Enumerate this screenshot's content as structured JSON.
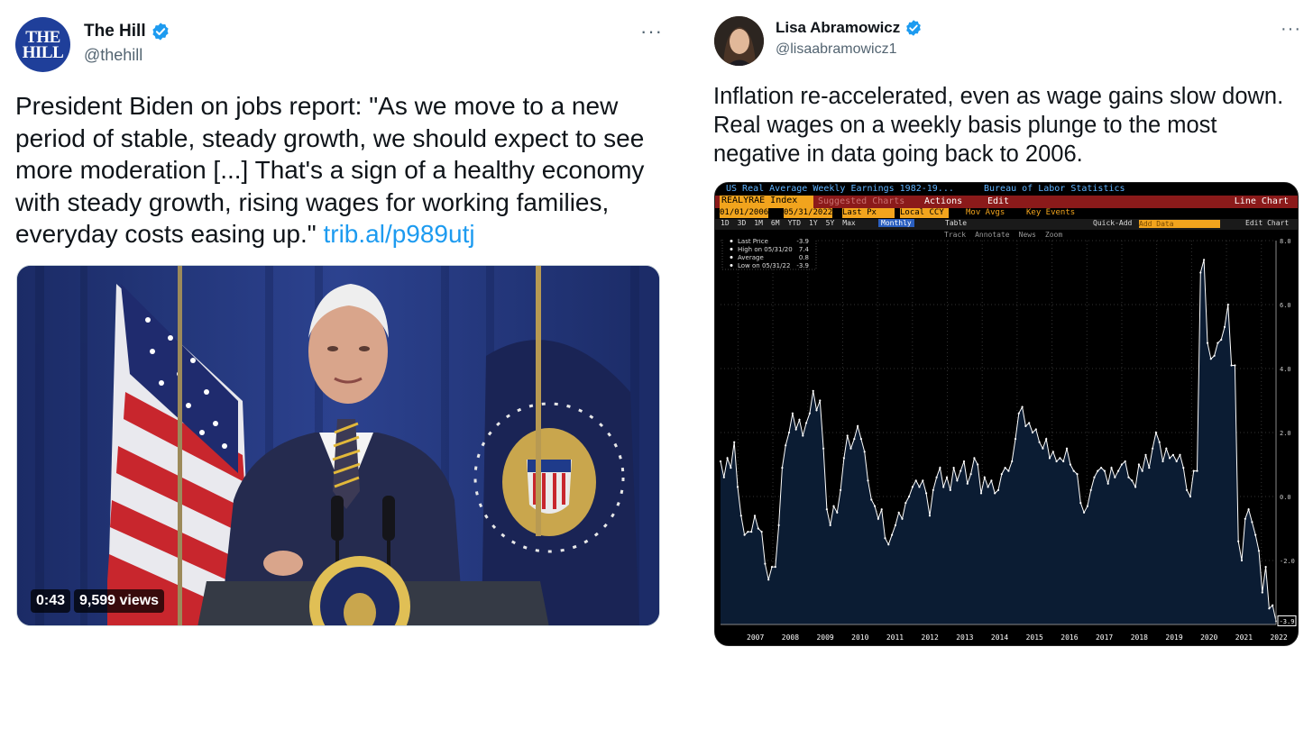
{
  "left_tweet": {
    "avatar_text_line1": "THE",
    "avatar_text_line2": "HILL",
    "display_name": "The Hill",
    "handle": "@thehill",
    "more_label": "···",
    "text": "President Biden on jobs report: \"As we move to a new period of stable, steady growth, we should expect to see more moderation [...] That's a sign of a healthy economy with steady growth, rising wages for working families, everyday costs easing up.\" ",
    "link": "trib.al/p989utj",
    "video": {
      "duration": "0:43",
      "views": "9,599 views"
    }
  },
  "right_tweet": {
    "display_name": "Lisa Abramowicz",
    "handle": "@lisaabramowicz1",
    "more_label": "···",
    "text": "Inflation re-accelerated, even as wage gains slow down. Real wages on a weekly basis plunge to the most negative in data going back to 2006."
  },
  "chart_ui": {
    "title": "US Real Average Weekly Earnings 1982-19...",
    "source": "Bureau of Labor Statistics",
    "ticker": "REALYRAE Index",
    "suggested": "Suggested Charts",
    "actions": "Actions",
    "edit": "Edit",
    "chart_type": "Line Chart",
    "start_date": "01/01/2006",
    "end_date": "05/31/2022",
    "field": "Last Px",
    "currency": "Local CCY",
    "mov_avgs": "Mov Avgs",
    "key_events": "Key Events",
    "ranges": [
      "1D",
      "3D",
      "1M",
      "6M",
      "YTD",
      "1Y",
      "5Y",
      "Max"
    ],
    "frequency": "Monthly",
    "table": "Table",
    "quick_add": "Quick-Add",
    "add_data": "Add Data",
    "edit_chart": "Edit Chart",
    "tools": [
      "Track",
      "Annotate",
      "News",
      "Zoom"
    ],
    "legend": [
      {
        "label": "Last Price",
        "value": "-3.9"
      },
      {
        "label": "High on 05/31/20",
        "value": "7.4"
      },
      {
        "label": "Average",
        "value": "0.8"
      },
      {
        "label": "Low on 05/31/22",
        "value": "-3.9"
      }
    ],
    "last_value_tag": "-3.9"
  },
  "chart_data": {
    "type": "area",
    "series_name": "REALYRAE Index",
    "y_ticks": [
      "8.0",
      "6.0",
      "4.0",
      "2.0",
      "0.0",
      "-2.0"
    ],
    "ylim": [
      -4.0,
      8.0
    ],
    "x_ticks": [
      "2007",
      "2008",
      "2009",
      "2010",
      "2011",
      "2012",
      "2013",
      "2014",
      "2015",
      "2016",
      "2017",
      "2018",
      "2019",
      "2020",
      "2021",
      "2022"
    ],
    "x_start": 2006.5,
    "x_end": 2022.42,
    "values": [
      1.1,
      0.6,
      1.2,
      0.9,
      1.7,
      0.3,
      -0.6,
      -1.2,
      -1.1,
      -1.1,
      -0.6,
      -1.0,
      -1.1,
      -2.1,
      -2.6,
      -2.2,
      -2.2,
      -0.9,
      0.9,
      1.6,
      2.0,
      2.6,
      2.1,
      2.4,
      1.9,
      2.3,
      2.6,
      3.3,
      2.7,
      3.0,
      1.5,
      -0.4,
      -0.9,
      -0.3,
      -0.5,
      0.2,
      1.2,
      1.9,
      1.5,
      1.8,
      2.2,
      1.8,
      1.4,
      0.5,
      -0.1,
      -0.3,
      -0.7,
      -0.4,
      -1.3,
      -1.5,
      -1.2,
      -0.9,
      -0.5,
      -0.7,
      -0.2,
      0.0,
      0.3,
      0.5,
      0.3,
      0.5,
      0.1,
      -0.6,
      0.2,
      0.6,
      0.9,
      0.3,
      0.6,
      0.2,
      0.9,
      0.5,
      0.8,
      1.1,
      0.4,
      0.7,
      1.2,
      1.0,
      0.1,
      0.6,
      0.3,
      0.5,
      0.1,
      0.2,
      0.7,
      0.9,
      0.8,
      1.1,
      1.8,
      2.6,
      2.8,
      2.2,
      2.3,
      2.0,
      2.1,
      1.7,
      1.5,
      1.8,
      1.2,
      1.4,
      1.1,
      1.2,
      1.1,
      1.5,
      1.0,
      0.8,
      0.7,
      -0.2,
      -0.5,
      -0.3,
      0.2,
      0.6,
      0.8,
      0.9,
      0.8,
      0.4,
      0.9,
      0.6,
      0.8,
      1.0,
      1.1,
      0.6,
      0.5,
      0.3,
      1.0,
      0.8,
      1.3,
      0.9,
      1.5,
      2.0,
      1.7,
      1.1,
      1.5,
      1.2,
      1.3,
      1.1,
      1.3,
      0.9,
      0.2,
      0.0,
      0.8,
      0.8,
      7.0,
      7.4,
      4.8,
      4.3,
      4.4,
      4.8,
      4.9,
      5.3,
      6.0,
      4.1,
      4.1,
      -1.4,
      -2.0,
      -0.7,
      -0.4,
      -0.8,
      -1.2,
      -1.7,
      -3.0,
      -2.2,
      -3.5,
      -3.4,
      -3.9
    ]
  },
  "colors": {
    "link": "#1d9bf0",
    "verified": "#1d9bf0",
    "chart_line": "#ffffff",
    "chart_fill": "#0b1c33",
    "bbg_red": "#8b1a1a",
    "bbg_orange": "#f2a41d",
    "bbg_blue_text": "#5fb3ff"
  }
}
